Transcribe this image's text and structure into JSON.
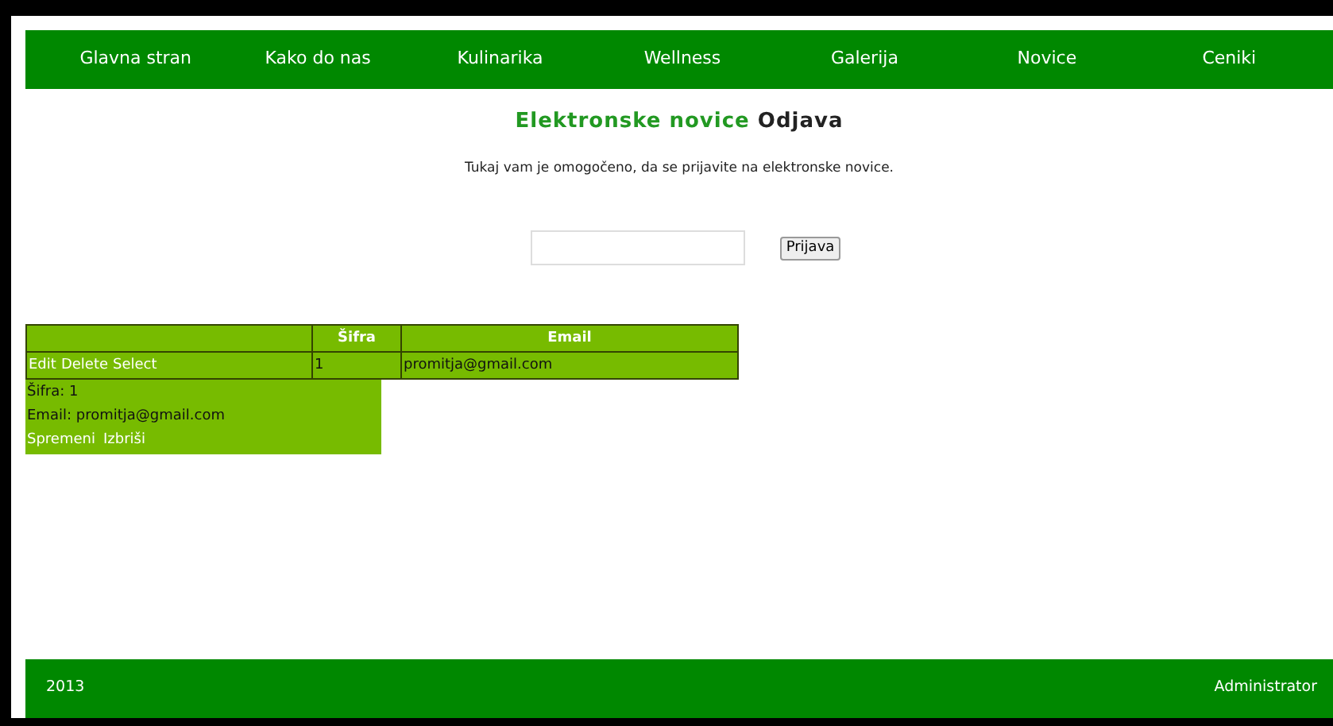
{
  "nav": [
    "Glavna stran",
    "Kako do nas",
    "Kulinarika",
    "Wellness",
    "Galerija",
    "Novice",
    "Ceniki"
  ],
  "heading": {
    "title": "Elektronske novice",
    "action": "Odjava"
  },
  "intro": "Tukaj vam je omogočeno, da se prijavite na elektronske novice.",
  "form": {
    "button": "Prijava"
  },
  "table": {
    "columns": [
      "Šifra",
      "Email"
    ],
    "rows": [
      {
        "actions": [
          "Edit",
          "Delete",
          "Select"
        ],
        "cells": [
          "1",
          "promitja@gmail.com"
        ]
      }
    ]
  },
  "detail": {
    "fields": [
      "Šifra: 1",
      "Email: promitja@gmail.com"
    ],
    "links": [
      "Spremeni",
      "Izbriši"
    ]
  },
  "footer": {
    "year": "2013",
    "user": "Administrator"
  }
}
